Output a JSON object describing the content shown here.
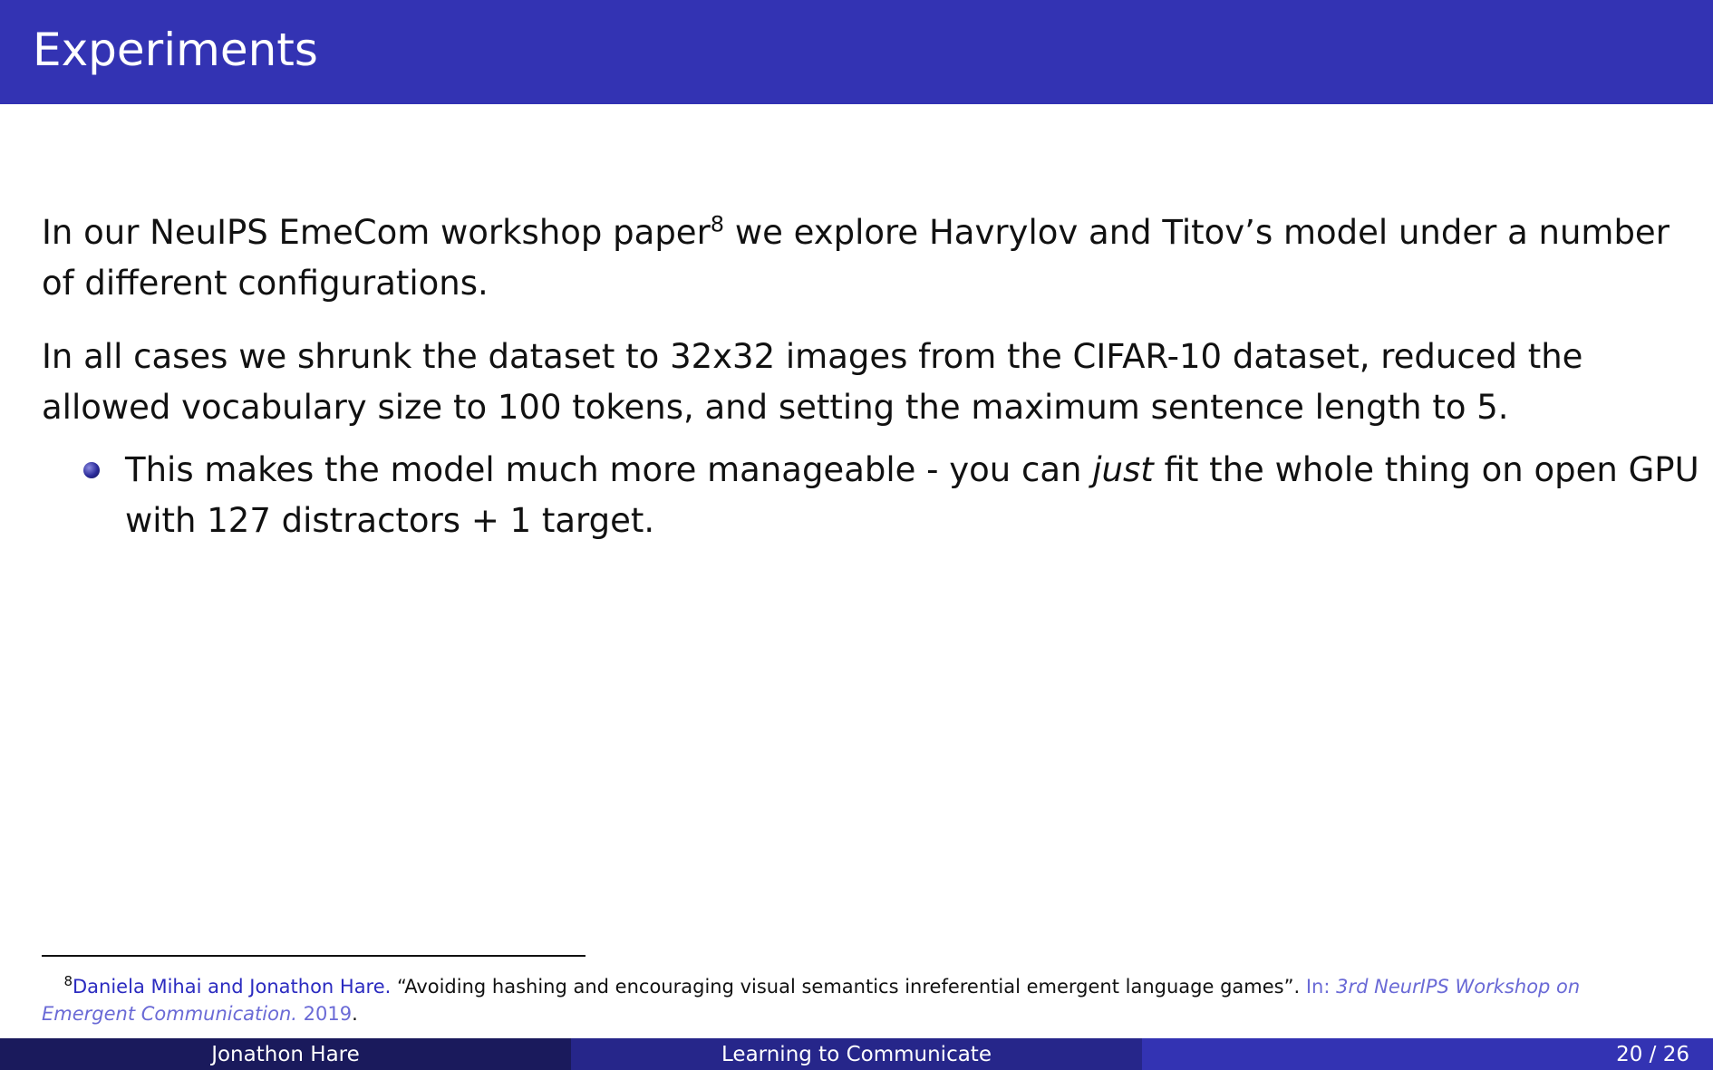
{
  "slide": {
    "title": "Experiments"
  },
  "body": {
    "para1_before": "In our NeuIPS EmeCom workshop paper",
    "para1_ref": "8",
    "para1_after": " we explore Havrylov and Titov’s model under a number of different configurations.",
    "para2": "In all cases we shrunk the dataset to 32x32 images from the CIFAR-10 dataset, reduced the allowed vocabulary size to 100 tokens, and setting the maximum sentence length to 5.",
    "bullet_before": "This makes the model much more manageable - you can ",
    "bullet_em": "just",
    "bullet_after": " fit the whole thing on open GPU with 127 distractors + 1 target."
  },
  "footnote": {
    "number": "8",
    "authors": "Daniela Mihai and Jonathon Hare.",
    "title": " “Avoiding hashing and encouraging visual semantics inreferential emergent language games”. ",
    "in_label": " In: ",
    "venue": "3rd NeurIPS Workshop on Emergent Communication.",
    "year": " 2019",
    "end": "."
  },
  "footer": {
    "author": "Jonathon Hare",
    "talk_title": "Learning to Communicate",
    "page": "20 / 26"
  },
  "colors": {
    "title_bar": "#3333b3",
    "footer_left": "#1a1a5c",
    "footer_middle": "#26268a",
    "footer_right": "#3333b3",
    "link": "#2b2bc0",
    "venue": "#6a6ad6"
  },
  "icons": {
    "bullet": "ball-bullet-icon"
  }
}
